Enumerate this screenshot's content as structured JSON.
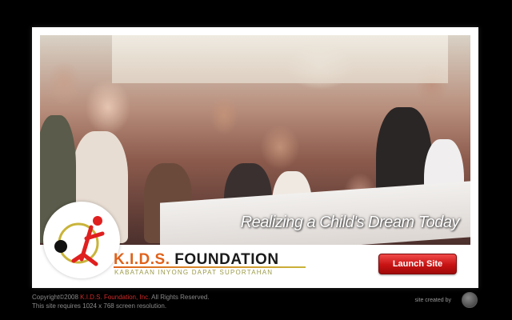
{
  "hero": {
    "tagline": "Realizing a Child's Dream Today"
  },
  "brand": {
    "name_prefix": "K.I.D.S.",
    "name_suffix": "FOUNDATION",
    "motto": "KABATAAN INYONG DAPAT SUPORTAHAN",
    "logo_icon": "stick-figure-logo-icon"
  },
  "actions": {
    "launch_label": "Launch Site"
  },
  "footer": {
    "copyright_prefix": "Copyright©2008",
    "copyright_org": "K.I.D.S. Foundation, Inc.",
    "copyright_suffix": "All Rights Reserved.",
    "resolution_note": "This site requires 1024 x 768 screen resolution.",
    "created_by": "site created by"
  },
  "colors": {
    "background": "#000000",
    "brand_orange": "#e0621a",
    "button_red": "#c81212"
  }
}
